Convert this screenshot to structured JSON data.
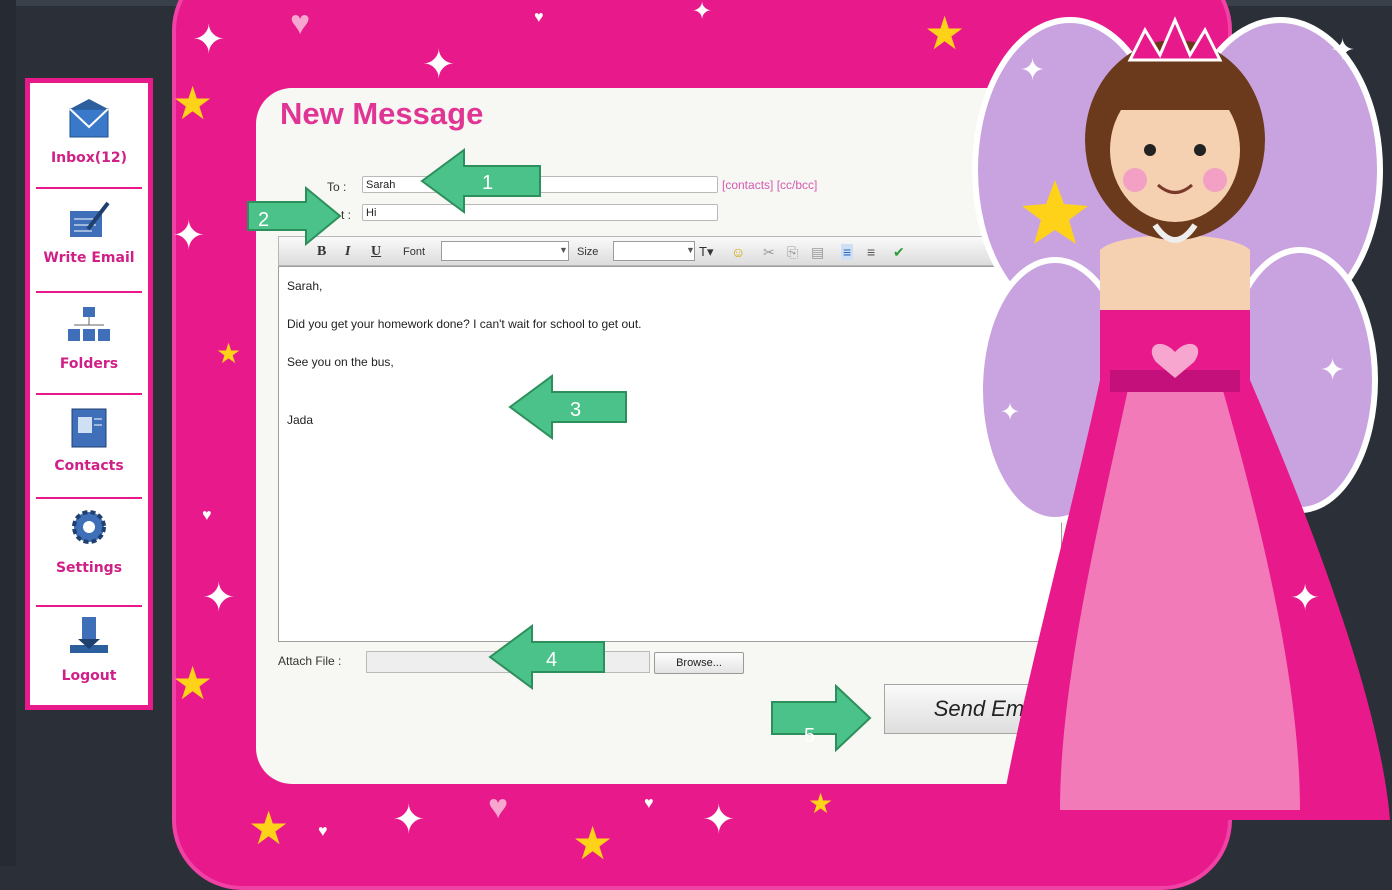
{
  "sidebar": {
    "items": [
      {
        "label": "Inbox(12)",
        "icon": "envelope-icon"
      },
      {
        "label": "Write Email",
        "icon": "pen-paper-icon"
      },
      {
        "label": "Folders",
        "icon": "folders-icon"
      },
      {
        "label": "Contacts",
        "icon": "address-book-icon"
      },
      {
        "label": "Settings",
        "icon": "gear-icon"
      },
      {
        "label": "Logout",
        "icon": "logout-icon"
      }
    ]
  },
  "compose": {
    "title": "New Message",
    "to_label": "To :",
    "to_value": "Sarah",
    "subject_label": "t :",
    "subject_value": "Hi",
    "links": "[contacts] [cc/bcc]"
  },
  "toolbar": {
    "bold": "B",
    "italic": "I",
    "underline": "U",
    "font_label": "Font",
    "size_label": "Size"
  },
  "body": {
    "lines": [
      "Sarah,",
      "Did you get your homework done? I can't wait for school to get out.",
      "See you on the bus,",
      "Jada"
    ]
  },
  "attach": {
    "label": "Attach File :",
    "browse": "Browse..."
  },
  "send": {
    "label": "Send Email!"
  },
  "callouts": [
    "1",
    "2",
    "3",
    "4",
    "5"
  ],
  "colors": {
    "frame_pink": "#e8198b",
    "callout_green": "#4cc28b",
    "title_pink": "#e03594"
  }
}
